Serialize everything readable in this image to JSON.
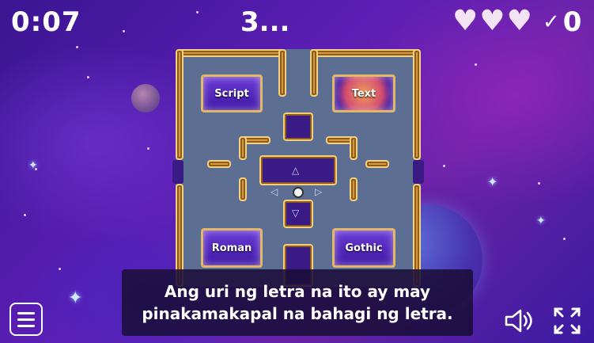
{
  "hud": {
    "timer": "0:07",
    "question_number": "3...",
    "lives": 3,
    "score": "0",
    "check_symbol": "✓",
    "heart_symbol": "♥"
  },
  "answers": [
    {
      "id": "script",
      "label": "Script"
    },
    {
      "id": "text",
      "label": "Text"
    },
    {
      "id": "roman",
      "label": "Roman"
    },
    {
      "id": "gothic",
      "label": "Gothic"
    }
  ],
  "question": "Ang uri ng letra na ito ay may pinakamakapal na bahagi ng letra.",
  "icons": {
    "menu": "menu-icon",
    "sound": "speaker-icon",
    "fullscreen": "fullscreen-icon",
    "player": "player-icon"
  },
  "colors": {
    "wall": "#d49a3e",
    "floor": "#5c6e92",
    "background": "#4a1ea0"
  }
}
